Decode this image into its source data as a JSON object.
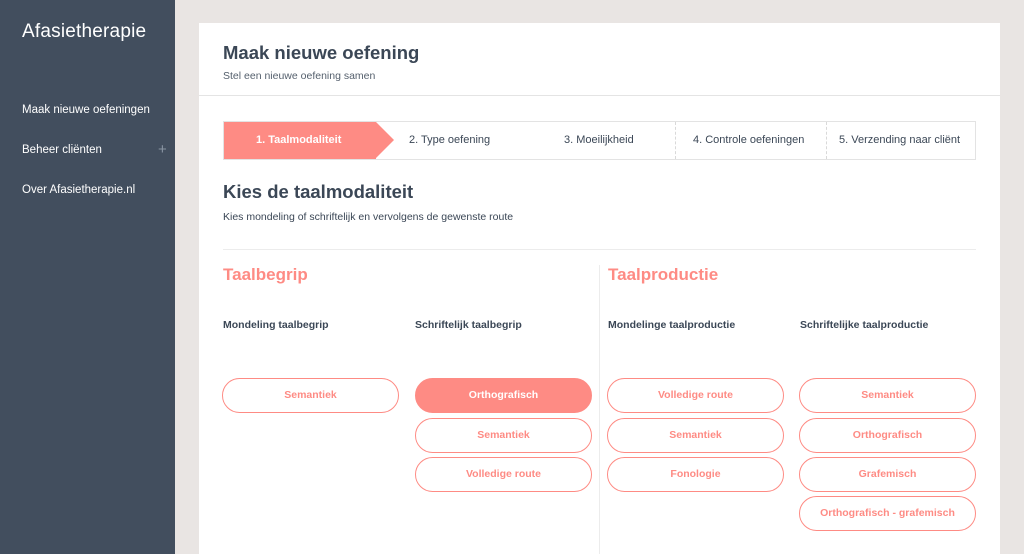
{
  "app": {
    "logo_mark": "A",
    "logo_rest": "fasietherapie"
  },
  "sidebar": {
    "items": [
      {
        "label": "Maak nieuwe oefeningen"
      },
      {
        "label": "Beheer cliënten",
        "expand_icon": "+"
      },
      {
        "label": "Over Afasietherapie.nl"
      }
    ]
  },
  "header": {
    "title": "Maak nieuwe oefening",
    "subtitle": "Stel een nieuwe oefening samen"
  },
  "steps": [
    {
      "label": "1. Taalmodaliteit",
      "active": true
    },
    {
      "label": "2. Type oefening",
      "active": false
    },
    {
      "label": "3. Moeilijkheid",
      "active": false
    },
    {
      "label": "4. Controle oefeningen",
      "active": false
    },
    {
      "label": "5. Verzending naar cliënt",
      "active": false
    }
  ],
  "section": {
    "title": "Kies de taalmodaliteit",
    "subtitle": "Kies mondeling of schriftelijk en vervolgens de gewenste route"
  },
  "groups": [
    {
      "title": "Taalbegrip",
      "columns": [
        {
          "heading": "Mondeling taalbegrip",
          "options": [
            "Semantiek"
          ]
        },
        {
          "heading": "Schriftelijk taalbegrip",
          "options": [
            "Orthografisch",
            "Semantiek",
            "Volledige route"
          ]
        }
      ]
    },
    {
      "title": "Taalproductie",
      "columns": [
        {
          "heading": "Mondelinge taalproductie",
          "options": [
            "Volledige route",
            "Semantiek",
            "Fonologie"
          ]
        },
        {
          "heading": "Schriftelijke taalproductie",
          "options": [
            "Semantiek",
            "Orthografisch",
            "Grafemisch",
            "Orthografisch - grafemisch"
          ]
        }
      ]
    }
  ],
  "selected_option": "Schriftelijk taalbegrip / Orthografisch",
  "colors": {
    "accent": "#fe8b84",
    "sidebar": "#424e5e",
    "text": "#3b4756",
    "background": "#e9e5e3"
  }
}
